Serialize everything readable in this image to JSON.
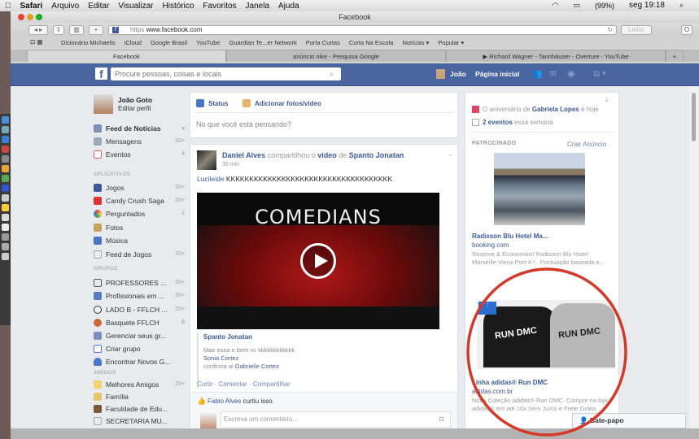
{
  "menubar": {
    "apple": "",
    "items": [
      "Safari",
      "Arquivo",
      "Editar",
      "Visualizar",
      "Histórico",
      "Favoritos",
      "Janela",
      "Ajuda"
    ],
    "battery": "(99%)",
    "clock": "seg 19:18"
  },
  "window": {
    "title": "Facebook",
    "url_scheme": "https",
    "url": "www.facebook.com",
    "reader": "Leitor"
  },
  "bookmarks": [
    "Dicionário Michaelis",
    "iCloud",
    "Google Brasil",
    "YouTube",
    "Guardian Te...er Network",
    "Porta Curtas",
    "Curta Na Escola",
    "Notícias ▾",
    "Popular ▾"
  ],
  "tabs": [
    {
      "label": "Facebook",
      "active": true
    },
    {
      "label": "anúncio nike - Pesquisa Google"
    },
    {
      "label": "▶ Richard Wagner - Tannhäuser - Overture - YouTube"
    }
  ],
  "fb": {
    "brand_color": "#4a64a0",
    "search_placeholder": "Procure pessoas, coisas e locais",
    "user": "João",
    "home": "Página inicial"
  },
  "left": {
    "profile": {
      "name": "João Goto",
      "edit": "Editar perfil"
    },
    "main": [
      {
        "label": "Feed de Notícias",
        "count": "▾"
      },
      {
        "label": "Mensagens",
        "count": "20+"
      },
      {
        "label": "Eventos",
        "count": "4"
      }
    ],
    "apps_title": "APLICATIVOS",
    "apps": [
      {
        "label": "Jogos",
        "count": "20+"
      },
      {
        "label": "Candy Crush Saga",
        "count": "20+"
      },
      {
        "label": "Perguntados",
        "count": "1"
      },
      {
        "label": "Fotos",
        "count": ""
      },
      {
        "label": "Música",
        "count": ""
      },
      {
        "label": "Feed de Jogos",
        "count": "20+"
      }
    ],
    "groups_title": "GRUPOS",
    "groups": [
      {
        "label": "PROFESSORES ...",
        "count": "20+"
      },
      {
        "label": "Profissionais em ...",
        "count": "20+"
      },
      {
        "label": "LADO B - FFLCH ...",
        "count": "20+"
      },
      {
        "label": "Basquete FFLCH",
        "count": "6"
      },
      {
        "label": "Gerenciar seus gr...",
        "count": ""
      },
      {
        "label": "Criar grupo",
        "count": ""
      },
      {
        "label": "Encontrar Novos G...",
        "count": ""
      }
    ],
    "friends_title": "AMIGOS",
    "friends": [
      {
        "label": "Melhores Amigos",
        "count": "20+"
      },
      {
        "label": "Família",
        "count": ""
      },
      {
        "label": "Faculdade de Edu...",
        "count": ""
      },
      {
        "label": "SECRETARIA MU...",
        "count": ""
      }
    ]
  },
  "composer": {
    "status": "Status",
    "photo": "Adicionar fotos/vídeo",
    "placeholder": "No que você está pensando?"
  },
  "post": {
    "author": "Daniel Alves",
    "shared": " compartilhou o ",
    "video": "vídeo",
    "de": " de ",
    "page": "Spanto Jonatan",
    "dot": ".",
    "time": "30 min ·",
    "mention": "Lucileide",
    "text": " KKKKKKKKKKKKKKKKKKKKKKKKKKKKKKKKKKKK",
    "video_title": "COMEDIANS",
    "shared_author": "Spanto Jonatan",
    "c1": "Mae essa e bem vc kkkkkkkkkkkk",
    "c2": "Sonia Cortez",
    "c3a": "confirma ai ",
    "c3b": "Gabrielle Cortez",
    "actions": "Curtir · Comentar · Compartilhar",
    "liker": "Fabio Alves",
    "liked": " curtiu isso.",
    "comment_placeholder": "Escreva um comentário..."
  },
  "right": {
    "bday_a": "O aniversário de ",
    "bday_name": "Gabriela Lopes",
    "bday_b": " é hoje",
    "events_a": "2 eventos",
    "events_b": " essa semana",
    "sponsored": "PATROCINADO",
    "create_ad": "Criar Anúncio",
    "ad1": {
      "title": "Radisson Blu Hotel Ma...",
      "domain": "booking.com",
      "text": "Reserve & Economize! Radisson Blu Hotel Marseille Vieux Port 4☆. Pontuação baseada e..."
    },
    "ad2": {
      "title": "Linha adidas® Run DMC",
      "domain": "adidas.com.br",
      "text": "Nova Coleção adidas® Run DMC. Compre na loja adidas® em até 10x Sem Juros e Frete Grátis",
      "shirt1": "RUN DMC",
      "shirt2": "RUN DMC"
    },
    "highlight_color": "#d33a2a"
  },
  "chat": {
    "label": "Bate-papo"
  }
}
